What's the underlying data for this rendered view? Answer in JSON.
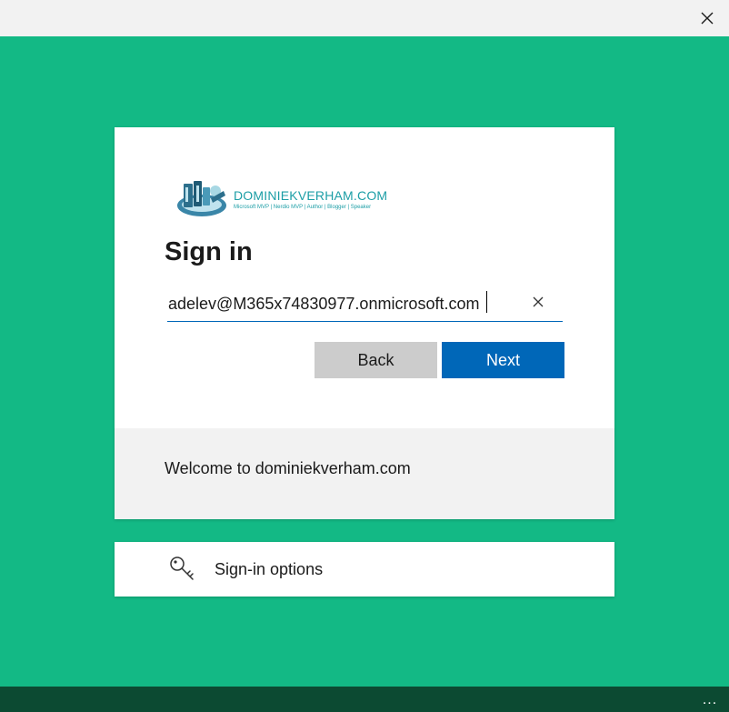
{
  "window": {
    "close_icon": "close-icon"
  },
  "logo": {
    "title": "DOMINIEKVERHAM.COM",
    "subtitle": "Microsoft MVP | Nerdio MVP | Author | Blogger | Speaker"
  },
  "signin": {
    "title": "Sign in",
    "email_value": "adelev@M365x74830977.onmicrosoft.com",
    "back_label": "Back",
    "next_label": "Next",
    "footer_text": "Welcome to dominiekverham.com"
  },
  "options": {
    "label": "Sign-in options",
    "icon": "key-icon"
  },
  "bottombar": {
    "more_label": "..."
  },
  "colors": {
    "background": "#13b985",
    "primary": "#0067b8",
    "bottombar": "#0c4a32",
    "logo": "#1c9ea6"
  }
}
